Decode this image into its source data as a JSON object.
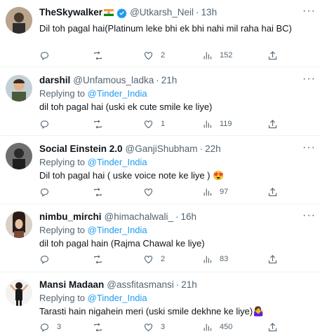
{
  "tweets": [
    {
      "name": "TheSkywalker",
      "handle": "@Utkarsh_Neil",
      "time": "13h",
      "replying_prefix": "Replying to",
      "replying_to": "@Tinder_India",
      "text": "Dil toh pagal hai(Platinum leke bhi ek bhi nahi mil raha hai BC)",
      "show_replying": false,
      "replies": "",
      "retweets": "",
      "likes": "2",
      "views": "152",
      "has_flag": true,
      "verified": true
    },
    {
      "name": "darshil",
      "handle": "@Unfamous_ladka",
      "time": "21h",
      "replying_prefix": "Replying to",
      "replying_to": "@Tinder_India",
      "text": "dil toh pagal hai (uski ek cute smile ke liye)",
      "show_replying": true,
      "replies": "",
      "retweets": "",
      "likes": "1",
      "views": "119"
    },
    {
      "name": "Social Einstein 2.0",
      "handle": "@GanjiShubham",
      "time": "22h",
      "replying_prefix": "Replying to",
      "replying_to": "@Tinder_India",
      "text": "Dil toh pagal hai ( uske voice note ke liye ) 😍",
      "show_replying": true,
      "replies": "",
      "retweets": "",
      "likes": "",
      "views": "97"
    },
    {
      "name": "nimbu_mirchi",
      "handle": "@himachalwali_",
      "time": "16h",
      "replying_prefix": "Replying to",
      "replying_to": "@Tinder_India",
      "text": "dil toh pagal hain (Rajma Chawal ke liye)",
      "show_replying": true,
      "replies": "",
      "retweets": "",
      "likes": "2",
      "views": "83"
    },
    {
      "name": "Mansi Madaan",
      "handle": "@assfitasmansi",
      "time": "21h",
      "replying_prefix": "Replying to",
      "replying_to": "@Tinder_India",
      "text": "Tarasti hain nigahein meri (uski smile dekhne ke liye)🤷‍♀️",
      "show_replying": true,
      "replies": "3",
      "retweets": "",
      "likes": "3",
      "views": "450"
    }
  ],
  "colors": {
    "accent": "#1d9bf0",
    "secondary_text": "#536471",
    "border": "#eff3f4"
  },
  "icons": [
    "more-icon",
    "reply-icon",
    "retweet-icon",
    "like-icon",
    "views-icon",
    "share-icon",
    "verified-badge-icon",
    "india-flag-icon"
  ]
}
